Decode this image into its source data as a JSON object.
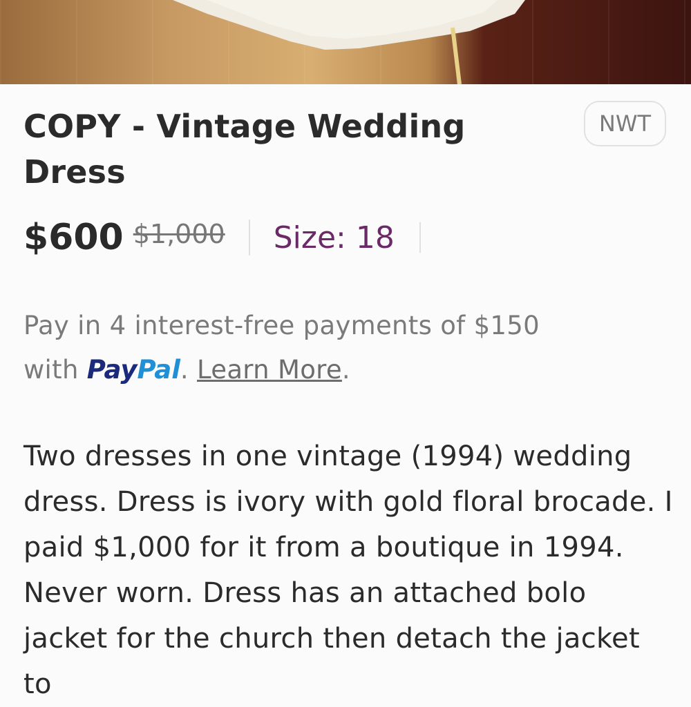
{
  "listing": {
    "title": "COPY - Vintage Wedding Dress",
    "condition_badge": "NWT",
    "price": "$600",
    "original_price": "$1,000",
    "size": "Size: 18"
  },
  "paypal": {
    "text_before": "Pay in 4 interest-free payments of $150 with ",
    "logo_pay": "Pay",
    "logo_pal": "Pal",
    "dot": ".",
    "learn_more": "Learn More",
    "trailing": "."
  },
  "description": "Two dresses in one vintage (1994) wedding dress. Dress is ivory with gold floral brocade. I paid $1,000 for it from a boutique in 1994. Never worn. Dress has an attached bolo jacket for the church then detach the jacket to",
  "icons": {
    "hero": "product-photo"
  }
}
